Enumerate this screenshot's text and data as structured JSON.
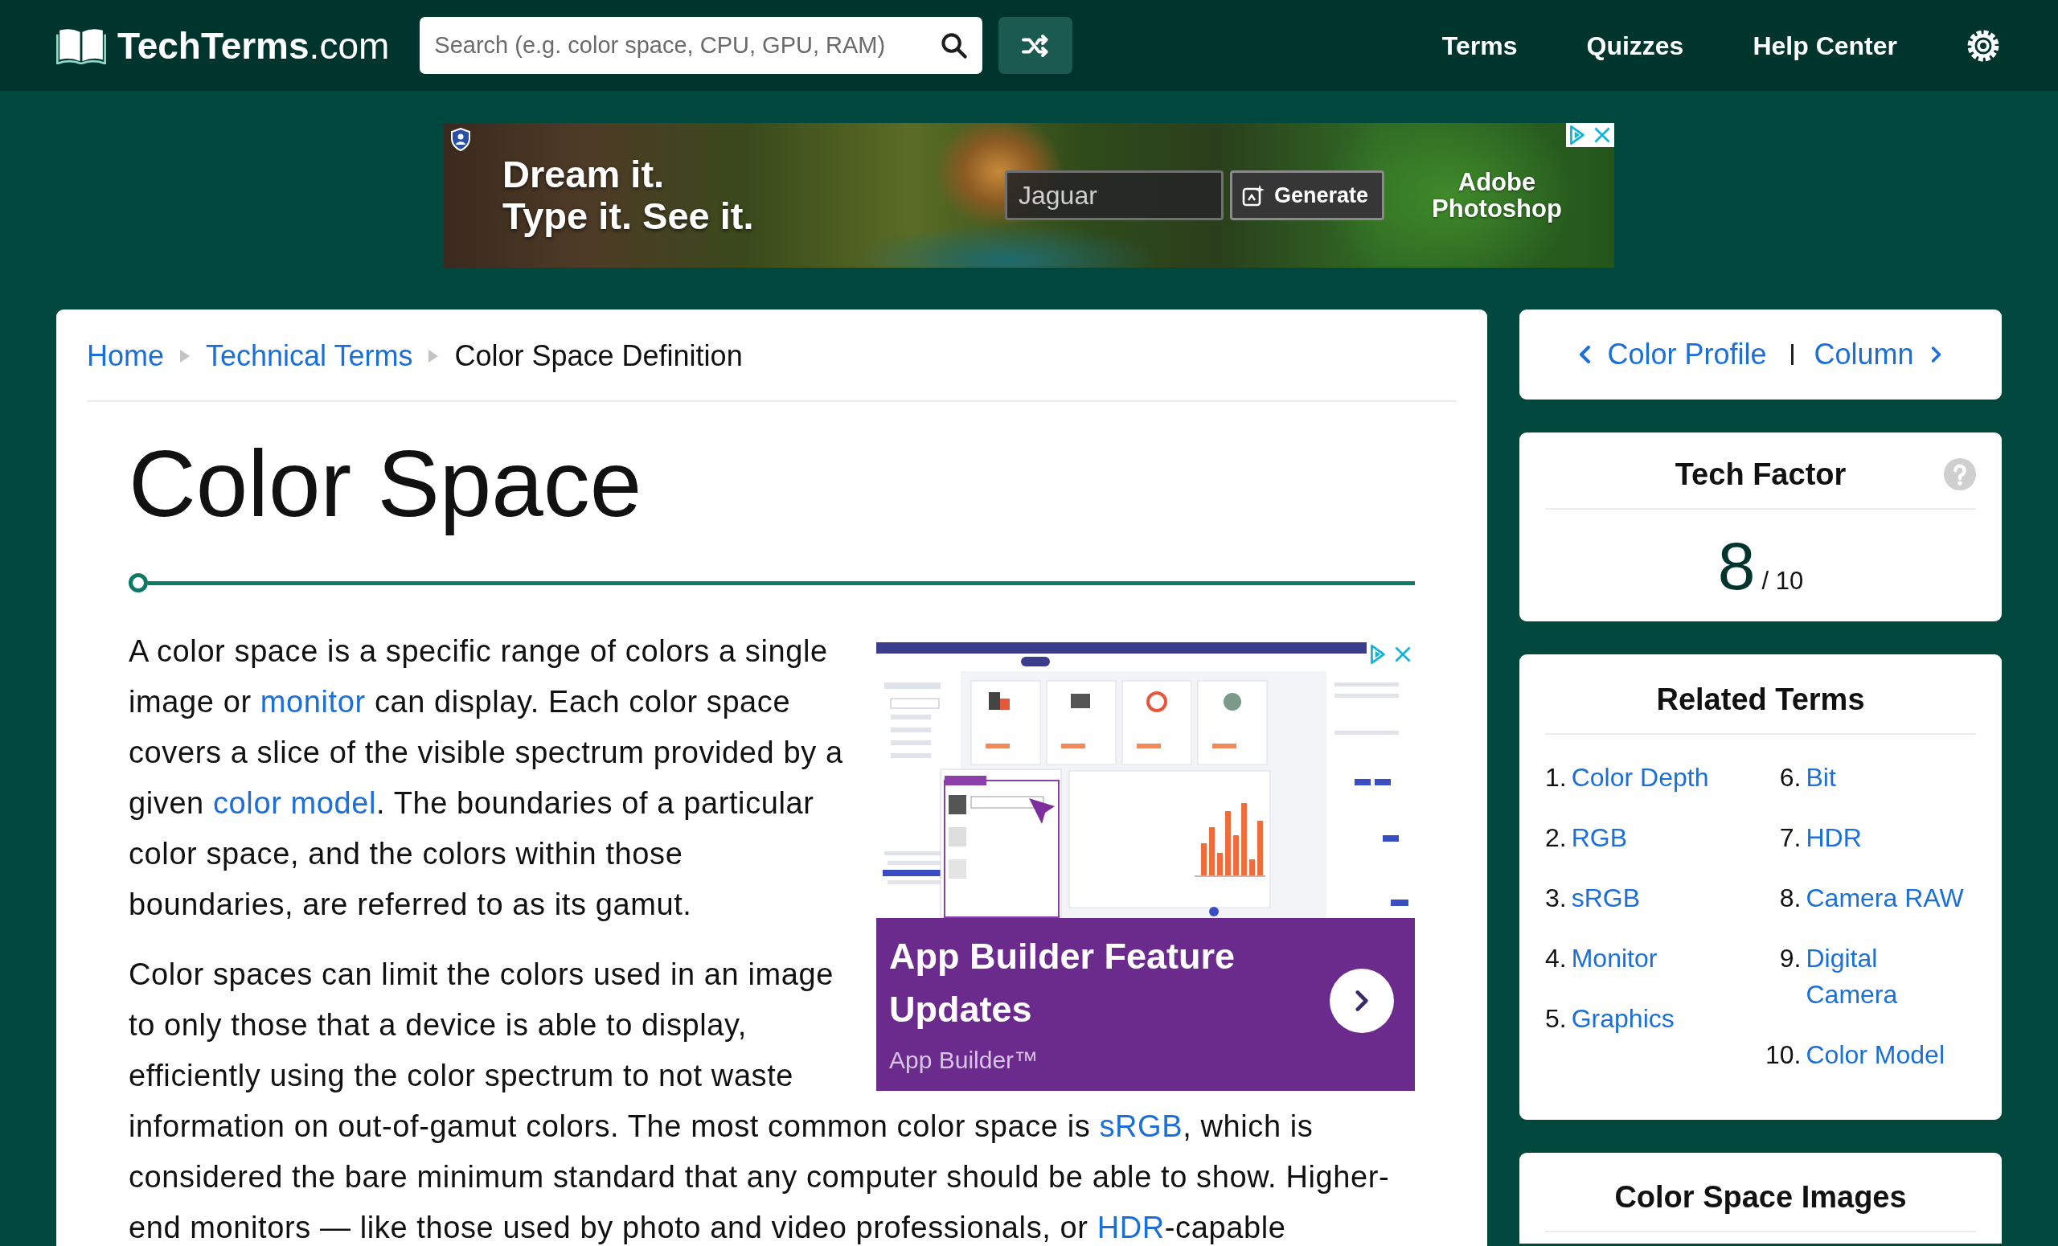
{
  "header": {
    "logo": "**TechTerms**.com",
    "search": {
      "placeholder": "Search (e.g. color space, CPU, GPU, RAM)"
    },
    "nav": [
      "Terms",
      "Quizzes",
      "Help Center"
    ]
  },
  "top_ad": {
    "headline": [
      "Dream it.",
      "Type it. See it."
    ],
    "prompt": {
      "value": "Jaguar"
    },
    "button": "Generate",
    "brand": "Adobe Photoshop"
  },
  "breadcrumb": [
    {
      "label": "Home",
      "kind": "link"
    },
    {
      "label": "Technical Terms",
      "kind": "link"
    },
    {
      "label": "Color Space Definition",
      "kind": "current"
    }
  ],
  "article": {
    "title": "Color Space",
    "paragraphs": [
      [
        [
          {
            "text": "A color space is a specific range of colors a single image or "
          },
          {
            "text": "monitor",
            "kind": "link"
          },
          {
            "text": " can display. Each color space covers a slice of the visible spectrum provided by a given "
          },
          {
            "text": "color model",
            "kind": "link"
          },
          {
            "text": ". The boundaries of a particular color space, and the colors within those boundaries, are referred to as its gamut."
          }
        ]
      ],
      [
        [
          {
            "text": "Color spaces can limit the colors used in an image to only those that a device is able to display, efficiently using the color spectrum to not waste"
          }
        ],
        [
          {
            "text": "information on out-of-gamut colors. The most common color space is "
          },
          {
            "text": "sRGB",
            "kind": "link"
          },
          {
            "text": ", which is considered the bare minimum standard that any computer should be able to show. Higher-end monitors — like those used by photo and video professionals, or "
          },
          {
            "text": "HDR",
            "kind": "link"
          },
          {
            "text": "-capable"
          }
        ]
      ]
    ],
    "ad": {
      "title": "App Builder Feature Updates",
      "advertiser": "App Builder™"
    }
  },
  "sidebar": {
    "term_nav": {
      "previous": "Color Profile",
      "next": "Column"
    },
    "tech_factor": {
      "title": "Tech Factor",
      "score": "8",
      "scale": "/ 10"
    },
    "related_terms": {
      "title": "Related Terms",
      "items": [
        {
          "number": "1.",
          "label": "Color Depth"
        },
        {
          "number": "2.",
          "label": "RGB"
        },
        {
          "number": "3.",
          "label": "sRGB"
        },
        {
          "number": "4.",
          "label": "Monitor"
        },
        {
          "number": "5.",
          "label": "Graphics"
        },
        {
          "number": "6.",
          "label": "Bit"
        },
        {
          "number": "7.",
          "label": "HDR"
        },
        {
          "number": "8.",
          "label": "Camera RAW"
        },
        {
          "number": "9.",
          "label": "Digital Camera"
        },
        {
          "number": "10.",
          "label": "Color Model"
        }
      ]
    },
    "images": {
      "title": "Color Space Images"
    }
  }
}
